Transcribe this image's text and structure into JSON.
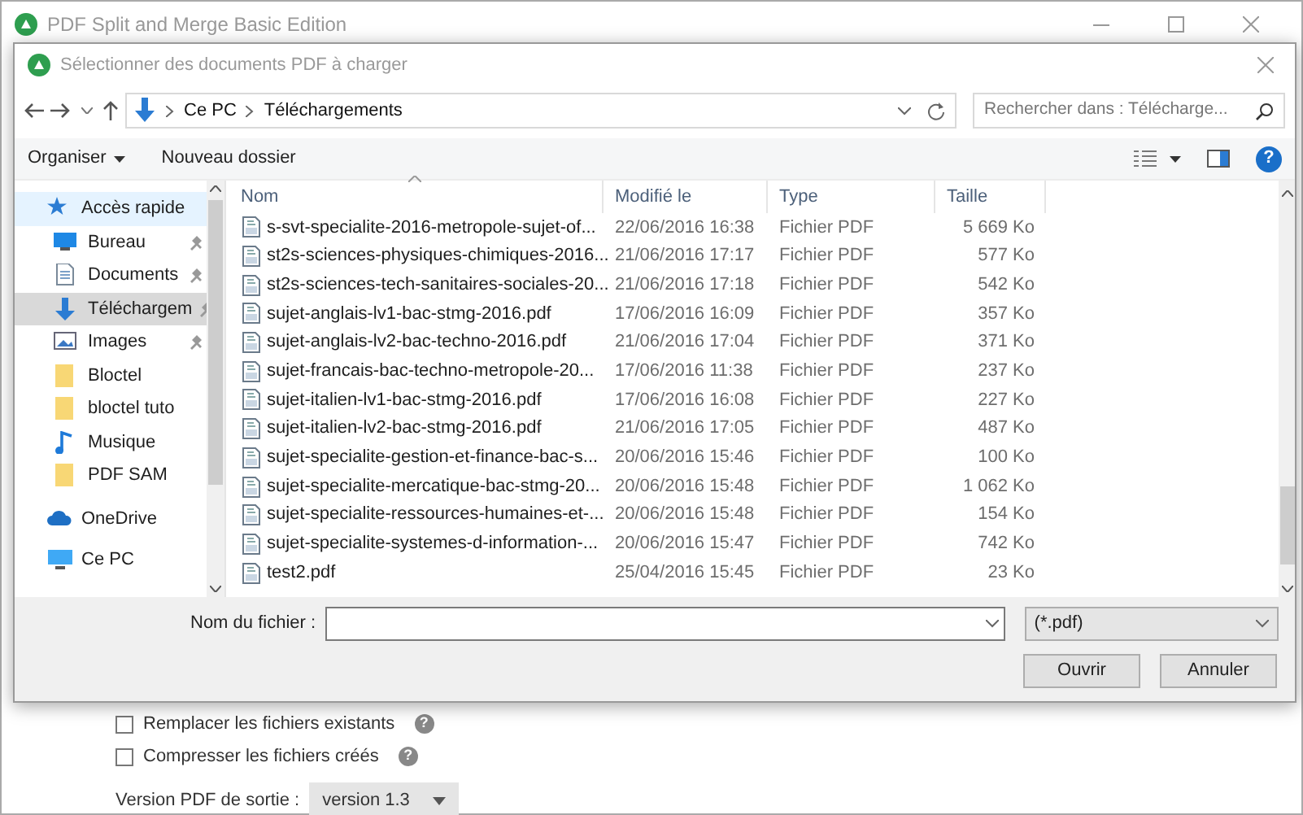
{
  "window": {
    "title": "PDF Split and Merge Basic Edition"
  },
  "dialog": {
    "title": "Sélectionner des documents PDF à charger",
    "breadcrumb": [
      "Ce PC",
      "Téléchargements"
    ],
    "search": {
      "placeholder": "Rechercher dans : Télécharge..."
    },
    "toolbar": {
      "organize": "Organiser",
      "new_folder": "Nouveau dossier",
      "help": "?"
    },
    "sidebar": [
      {
        "label": "Accès rapide",
        "kind": "star",
        "selected": false,
        "children": [
          {
            "label": "Bureau",
            "kind": "desktop",
            "pinned": true,
            "selected": false
          },
          {
            "label": "Documents",
            "kind": "document",
            "pinned": true,
            "selected": false
          },
          {
            "label": "Téléchargem",
            "kind": "download",
            "pinned": true,
            "selected": true
          },
          {
            "label": "Images",
            "kind": "images",
            "pinned": true,
            "selected": false
          },
          {
            "label": "Bloctel",
            "kind": "folder",
            "pinned": false,
            "selected": false
          },
          {
            "label": "bloctel tuto",
            "kind": "folder",
            "pinned": false,
            "selected": false
          },
          {
            "label": "Musique",
            "kind": "music",
            "pinned": false,
            "selected": false
          },
          {
            "label": "PDF SAM",
            "kind": "folder",
            "pinned": false,
            "selected": false
          }
        ]
      },
      {
        "label": "OneDrive",
        "kind": "cloud",
        "selected": false
      },
      {
        "label": "Ce PC",
        "kind": "pc",
        "selected": false
      }
    ],
    "columns": [
      "Nom",
      "Modifié le",
      "Type",
      "Taille"
    ],
    "rows": [
      [
        "s-svt-specialite-2016-metropole-sujet-of...",
        "22/06/2016 16:38",
        "Fichier PDF",
        "5 669 Ko"
      ],
      [
        "st2s-sciences-physiques-chimiques-2016...",
        "21/06/2016 17:17",
        "Fichier PDF",
        "577 Ko"
      ],
      [
        "st2s-sciences-tech-sanitaires-sociales-20...",
        "21/06/2016 17:18",
        "Fichier PDF",
        "542 Ko"
      ],
      [
        "sujet-anglais-lv1-bac-stmg-2016.pdf",
        "17/06/2016 16:09",
        "Fichier PDF",
        "357 Ko"
      ],
      [
        "sujet-anglais-lv2-bac-techno-2016.pdf",
        "21/06/2016 17:04",
        "Fichier PDF",
        "371 Ko"
      ],
      [
        "sujet-francais-bac-techno-metropole-20...",
        "17/06/2016 11:38",
        "Fichier PDF",
        "237 Ko"
      ],
      [
        "sujet-italien-lv1-bac-stmg-2016.pdf",
        "17/06/2016 16:08",
        "Fichier PDF",
        "227 Ko"
      ],
      [
        "sujet-italien-lv2-bac-stmg-2016.pdf",
        "21/06/2016 17:05",
        "Fichier PDF",
        "487 Ko"
      ],
      [
        "sujet-specialite-gestion-et-finance-bac-s...",
        "20/06/2016 15:46",
        "Fichier PDF",
        "100 Ko"
      ],
      [
        "sujet-specialite-mercatique-bac-stmg-20...",
        "20/06/2016 15:48",
        "Fichier PDF",
        "1 062 Ko"
      ],
      [
        "sujet-specialite-ressources-humaines-et-...",
        "20/06/2016 15:48",
        "Fichier PDF",
        "154 Ko"
      ],
      [
        "sujet-specialite-systemes-d-information-...",
        "20/06/2016 15:47",
        "Fichier PDF",
        "742 Ko"
      ],
      [
        "test2.pdf",
        "25/04/2016 15:45",
        "Fichier PDF",
        "23 Ko"
      ]
    ],
    "filename": {
      "label": "Nom du fichier :"
    },
    "filter": "(*.pdf)",
    "buttons": [
      "Ouvrir",
      "Annuler"
    ]
  },
  "options": [
    {
      "label": "Remplacer les fichiers existants",
      "checked": false,
      "help": "?"
    },
    {
      "label": "Compresser les fichiers créés",
      "checked": false,
      "help": "?"
    }
  ],
  "version": {
    "label": "Version PDF de sortie :",
    "value": "version 1.3"
  }
}
